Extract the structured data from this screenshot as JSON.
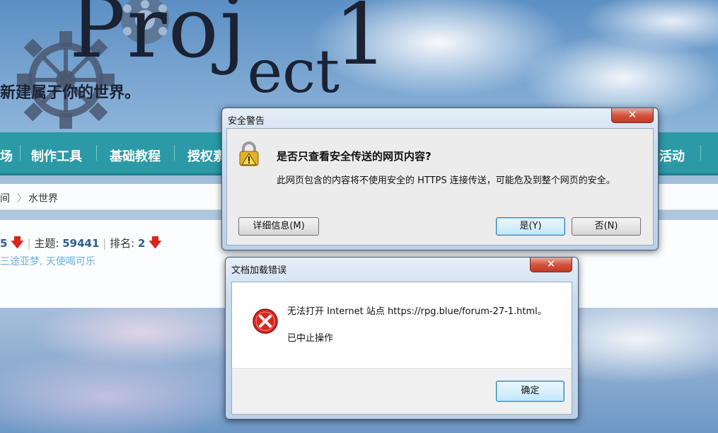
{
  "page": {
    "logo_text": "Proj",
    "logo_text_small": "ect",
    "logo_number": "1",
    "slogan": "新建属于你的世界。",
    "nav": [
      "场",
      "制作工具",
      "基础教程",
      "授权素",
      "活动"
    ],
    "breadcrumb": [
      "间",
      "〉",
      "水世界"
    ],
    "stats": {
      "prefix_value": "5",
      "topics_label": "主题:",
      "topics_value": "59441",
      "rank_label": "排名:",
      "rank_value": "2",
      "links": "三途亚梦, 天使喝可乐"
    }
  },
  "security_dialog": {
    "title": "安全警告",
    "close_label": "✕",
    "question": "是否只查看安全传送的网页内容?",
    "message": "此网页包含的内容将不使用安全的 HTTPS 连接传送，可能危及到整个网页的安全。",
    "details_button": "详细信息(M)",
    "yes_button": "是(Y)",
    "no_button": "否(N)",
    "icon": "lock-warning-icon"
  },
  "error_dialog": {
    "title": "文档加载错误",
    "close_label": "✕",
    "message": "无法打开 Internet 站点 https://rpg.blue/forum-27-1.html。",
    "sub_message": "已中止操作",
    "ok_button": "确定",
    "icon": "error-icon"
  }
}
